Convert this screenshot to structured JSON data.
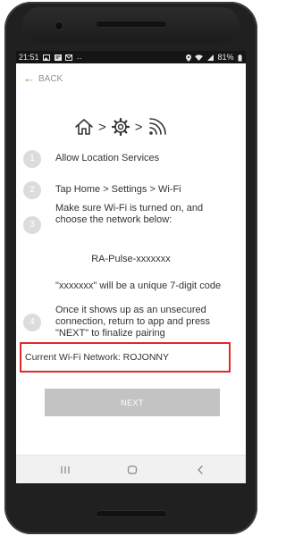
{
  "status_bar": {
    "time": "21:51",
    "left_icons": [
      "image-icon",
      "app-icon",
      "email-icon",
      "more-dots-icon"
    ],
    "battery": "81%"
  },
  "header": {
    "back_label": "BACK"
  },
  "path_icons": [
    "home-icon",
    "gear-icon",
    "wifi-icon"
  ],
  "steps": [
    {
      "number": "1",
      "text": "Allow Location Services"
    },
    {
      "number": "2",
      "text": "Tap Home > Settings > Wi-Fi"
    },
    {
      "number": "3",
      "text_line1": "Make sure Wi-Fi is turned on, and",
      "text_line2": "choose the network below:"
    },
    {
      "number": "4",
      "text_line1": "Once it shows up as an unsecured",
      "text_line2": "connection, return to app and press",
      "text_line3": "\"NEXT\" to finalize pairing"
    }
  ],
  "network_name": "RA-Pulse-xxxxxxx",
  "unique_note": "\"xxxxxxx\" will be a unique 7-digit code",
  "current_network": "Current Wi-Fi Network: ROJONNY",
  "next_button": "NEXT",
  "colors": {
    "accent_back_arrow": "#b48a5a",
    "highlight_border": "#e0282b",
    "disabled_button": "#c3c3c3",
    "step_circle": "#dcdcdc"
  }
}
